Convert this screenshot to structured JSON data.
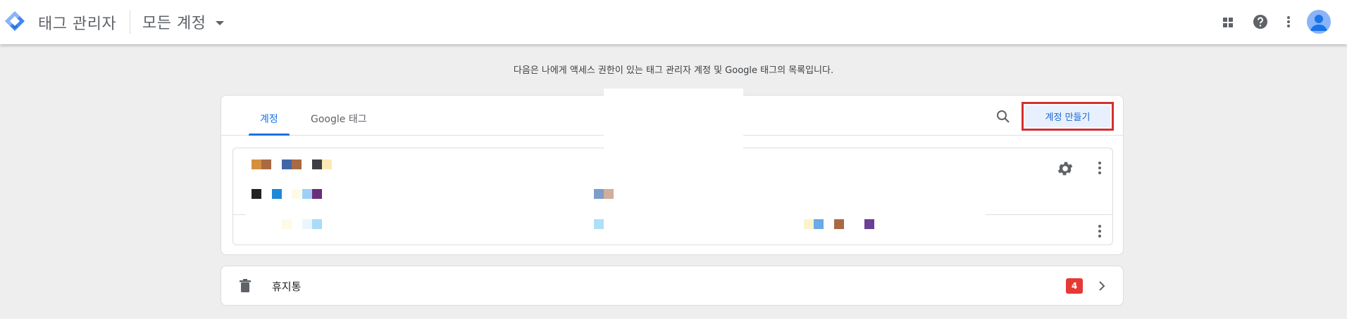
{
  "header": {
    "app_title": "태그 관리자",
    "account_selector": "모든 계정"
  },
  "intro_text": "다음은 나에게 액세스 권한이 있는 태그 관리자 계정 및 Google 태그의 목록입니다.",
  "tabs": [
    {
      "label": "계정",
      "active": true
    },
    {
      "label": "Google 태그",
      "active": false
    }
  ],
  "create_account_label": "계정 만들기",
  "trash": {
    "label": "휴지통",
    "count": "4"
  },
  "colors": {
    "accent": "#1a73e8",
    "highlight_box": "#d32f2f",
    "badge": "#e53935",
    "background": "#eeeeee"
  },
  "icons": [
    "tag-manager-logo-icon",
    "caret-down-icon",
    "apps-grid-icon",
    "help-icon",
    "more-vert-icon",
    "account-avatar-icon",
    "search-icon",
    "gear-icon",
    "trash-icon",
    "chevron-right-icon"
  ]
}
